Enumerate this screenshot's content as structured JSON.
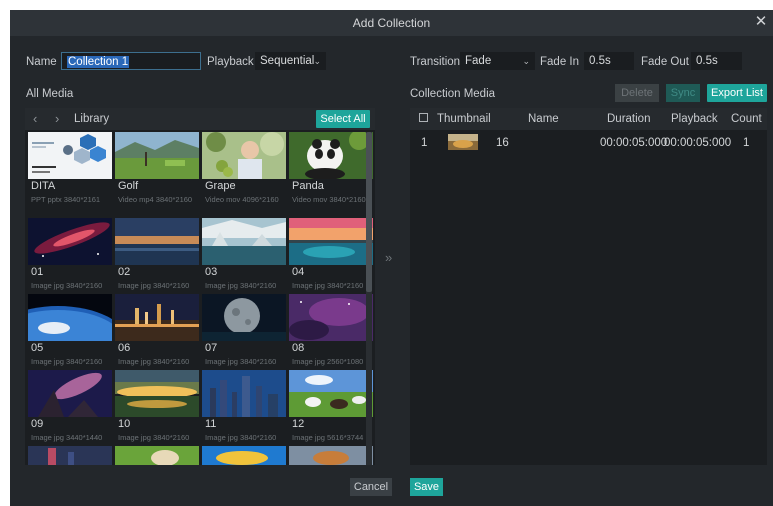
{
  "dialog": {
    "title": "Add Collection",
    "close_icon": "close-icon"
  },
  "name": {
    "label": "Name",
    "value": "Collection 1"
  },
  "playback": {
    "label": "Playback",
    "value": "Sequential"
  },
  "transition": {
    "label": "Transition",
    "value": "Fade"
  },
  "fade_in": {
    "label": "Fade In",
    "value": "0.5s"
  },
  "fade_out": {
    "label": "Fade Out",
    "value": "0.5s"
  },
  "all_media": {
    "label": "All Media",
    "breadcrumb": "Library",
    "select_all": "Select All",
    "items": [
      {
        "name": "DITA",
        "meta": "PPT pptx 3840*2161"
      },
      {
        "name": "Golf",
        "meta": "Video mp4 3840*2160"
      },
      {
        "name": "Grape",
        "meta": "Video mov 4096*2160"
      },
      {
        "name": "Panda",
        "meta": "Video mov 3840*2160"
      },
      {
        "name": "01",
        "meta": "Image jpg 3840*2160"
      },
      {
        "name": "02",
        "meta": "Image jpg 3840*2160"
      },
      {
        "name": "03",
        "meta": "Image jpg 3840*2160"
      },
      {
        "name": "04",
        "meta": "Image jpg 3840*2160"
      },
      {
        "name": "05",
        "meta": "Image jpg 3840*2160"
      },
      {
        "name": "06",
        "meta": "Image jpg 3840*2160"
      },
      {
        "name": "07",
        "meta": "Image jpg 3840*2160"
      },
      {
        "name": "08",
        "meta": "Image jpg 2560*1080"
      },
      {
        "name": "09",
        "meta": "Image jpg 3440*1440"
      },
      {
        "name": "10",
        "meta": "Image jpg 3840*2160"
      },
      {
        "name": "11",
        "meta": "Image jpg 3840*2160"
      },
      {
        "name": "12",
        "meta": "Image jpg 5616*3744"
      }
    ]
  },
  "collection_media": {
    "label": "Collection Media",
    "delete": "Delete",
    "sync": "Sync",
    "export_list": "Export List",
    "columns": {
      "thumbnail": "Thumbnail",
      "name": "Name",
      "duration": "Duration",
      "playback": "Playback",
      "count": "Count"
    },
    "rows": [
      {
        "index": "1",
        "thumb_count": "16",
        "name": "",
        "duration": "00:00:05:000",
        "playback": "00:00:05:000",
        "count": "1"
      }
    ]
  },
  "footer": {
    "cancel": "Cancel",
    "save": "Save"
  },
  "colors": {
    "accent": "#1ea59b",
    "background": "#23272b",
    "panel": "#1b1e21"
  }
}
